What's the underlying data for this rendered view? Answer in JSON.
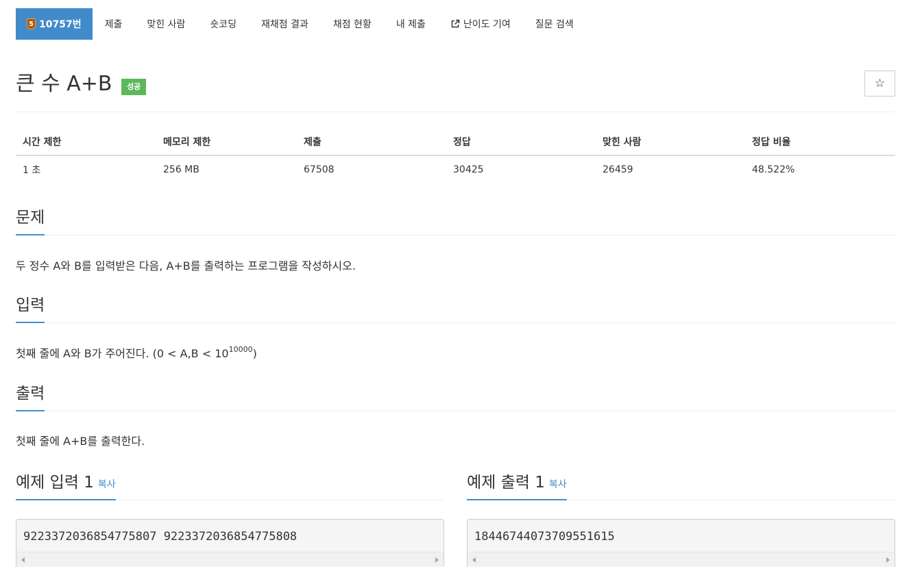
{
  "nav": {
    "problem_tab": {
      "tier": "5",
      "label": "10757번"
    },
    "tabs": [
      {
        "label": "제출"
      },
      {
        "label": "맞힌 사람"
      },
      {
        "label": "숏코딩"
      },
      {
        "label": "재채점 결과"
      },
      {
        "label": "채점 현황"
      },
      {
        "label": "내 제출"
      },
      {
        "label": "난이도 기여",
        "icon": "external-link-icon"
      },
      {
        "label": "질문 검색"
      }
    ]
  },
  "problem": {
    "title": "큰 수 A+B",
    "status": "성공",
    "star_icon": "star-outline-icon",
    "star_glyph": "☆"
  },
  "info": {
    "headers": [
      "시간 제한",
      "메모리 제한",
      "제출",
      "정답",
      "맞힌 사람",
      "정답 비율"
    ],
    "values": [
      "1 초",
      "256 MB",
      "67508",
      "30425",
      "26459",
      "48.522%"
    ]
  },
  "sections": {
    "description": {
      "heading": "문제",
      "text": "두 정수 A와 B를 입력받은 다음, A+B를 출력하는 프로그램을 작성하시오."
    },
    "input": {
      "heading": "입력",
      "text_before": "첫째 줄에 A와 B가 주어진다. (0 < A,B < 10",
      "exponent": "10000",
      "text_after": ")"
    },
    "output": {
      "heading": "출력",
      "text": "첫째 줄에 A+B를 출력한다."
    }
  },
  "samples": {
    "input": {
      "heading": "예제 입력 1",
      "copy_label": "복사",
      "content": "9223372036854775807 9223372036854775808"
    },
    "output": {
      "heading": "예제 출력 1",
      "copy_label": "복사",
      "content": "18446744073709551615"
    }
  },
  "colors": {
    "accent": "#428bca",
    "success": "#5cb85c",
    "tier_bronze": "#ad5600"
  }
}
